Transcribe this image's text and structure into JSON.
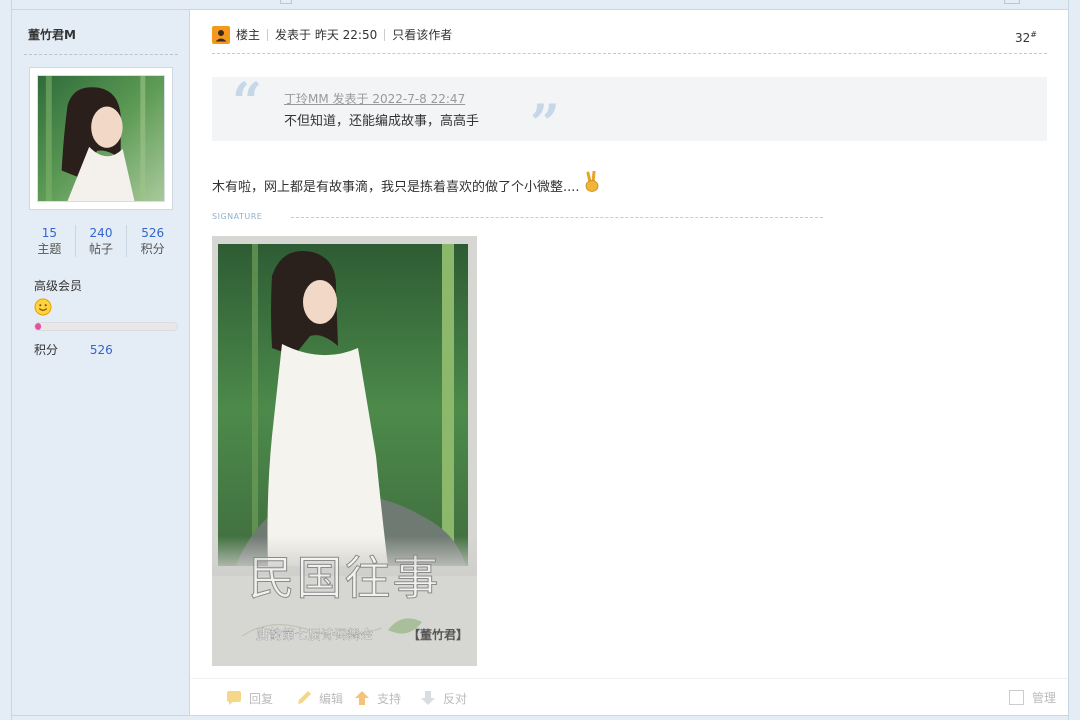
{
  "author": {
    "name": "董竹君M",
    "stats": [
      {
        "value": "15",
        "label": "主题"
      },
      {
        "value": "240",
        "label": "帖子"
      },
      {
        "value": "526",
        "label": "积分"
      }
    ],
    "group": "高级会员",
    "level_progress": 0.04,
    "points_label": "积分",
    "points_value": "526"
  },
  "post": {
    "owner_label": "楼主",
    "posted_at": "发表于 昨天 22:50",
    "only_author_link": "只看该作者",
    "floor": "32",
    "floor_suffix": "#",
    "quote": {
      "author_line": "丁玲MM 发表于 2022-7-8 22:47",
      "text": "不但知道，还能编成故事，高高手",
      "open_mark": "“",
      "close_mark": "”"
    },
    "body": "木有啦，网上都是有故事滴，我只是拣着喜欢的做了个小微整....",
    "signature_label": "SIGNATURE",
    "signature_image": {
      "title": "民国往事",
      "subtitle": "唐韵第七届诗词舞会",
      "signed": "【董竹君】"
    }
  },
  "actions": {
    "reply": "回复",
    "edit": "编辑",
    "support": "支持",
    "oppose": "反对",
    "manage": "管理"
  },
  "icons": {
    "owner": "landlord-icon",
    "emoticon": "victory-hand-icon",
    "group": "smile-face-icon"
  },
  "colors": {
    "link_blue": "#3366cc",
    "sidebar_bg": "#e4ecf5",
    "level_fill": "#e64fa6",
    "owner_badge": "#f39a1e"
  }
}
